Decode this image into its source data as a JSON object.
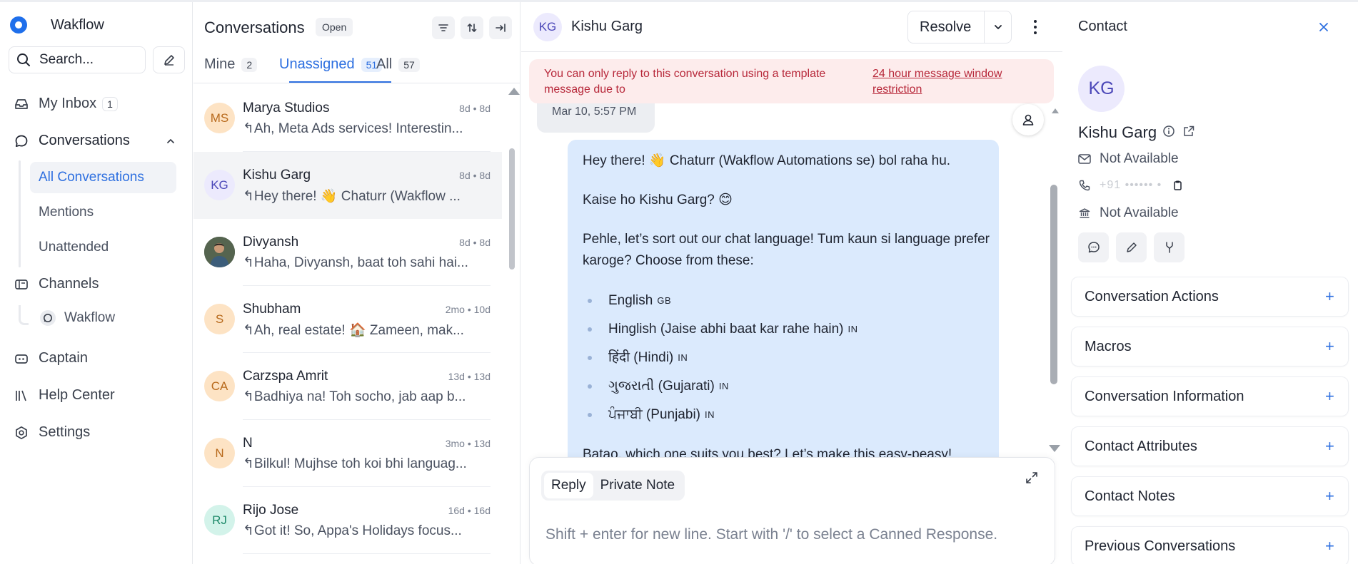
{
  "app": {
    "name": "Wakflow"
  },
  "nav": {
    "search_placeholder": "Search...",
    "my_inbox": {
      "label": "My Inbox",
      "count": "1"
    },
    "conversations_label": "Conversations",
    "sub_items": [
      {
        "label": "All Conversations",
        "active": true
      },
      {
        "label": "Mentions",
        "active": false
      },
      {
        "label": "Unattended",
        "active": false
      }
    ],
    "channels_label": "Channels",
    "channel_item": "Wakflow",
    "captain_label": "Captain",
    "help_center_label": "Help Center",
    "settings_label": "Settings"
  },
  "list": {
    "title": "Conversations",
    "status_pill": "Open",
    "tabs": [
      {
        "label": "Mine",
        "count": "2"
      },
      {
        "label": "Unassigned",
        "count": "51"
      },
      {
        "label": "All",
        "count": "57"
      }
    ],
    "conversations": [
      {
        "initials": "MS",
        "name": "Marya Studios",
        "time": "8d • 8d",
        "message": "↰Ah, Meta Ads services! Interestin...",
        "avatar_bg": "#fde3c4",
        "avatar_fg": "#b86a1c"
      },
      {
        "initials": "KG",
        "name": "Kishu Garg",
        "time": "8d • 8d",
        "message": "↰Hey there! 👋 Chaturr (Wakflow ...",
        "avatar_bg": "#eceafd",
        "avatar_fg": "#4b47b8"
      },
      {
        "initials": "",
        "name": "Divyansh",
        "time": "8d • 8d",
        "message": "↰Haha, Divyansh, baat toh sahi hai...",
        "avatar_bg": "#3e4a3c",
        "avatar_fg": "#ffffff"
      },
      {
        "initials": "S",
        "name": "Shubham",
        "time": "2mo • 10d",
        "message": "↰Ah, real estate! 🏠 Zameen, mak...",
        "avatar_bg": "#fde3c4",
        "avatar_fg": "#b86a1c"
      },
      {
        "initials": "CA",
        "name": "Carzspa Amrit",
        "time": "13d • 13d",
        "message": "↰Badhiya na! Toh socho, jab aap b...",
        "avatar_bg": "#fde3c4",
        "avatar_fg": "#b86a1c"
      },
      {
        "initials": "N",
        "name": "N",
        "time": "3mo • 13d",
        "message": "↰Bilkul! Mujhse toh koi bhi languag...",
        "avatar_bg": "#fde3c4",
        "avatar_fg": "#b86a1c"
      },
      {
        "initials": "RJ",
        "name": "Rijo Jose",
        "time": "16d • 16d",
        "message": "↰Got it! So, Appa's Holidays focus...",
        "avatar_bg": "#d3f3ea",
        "avatar_fg": "#1f8a6a"
      }
    ]
  },
  "chat": {
    "contact_initials": "KG",
    "contact_name": "Kishu Garg",
    "resolve_label": "Resolve",
    "warning_text": "You can only reply to this conversation using a template message due to",
    "warning_link": "24 hour message window restriction",
    "prev_timestamp": "Mar 10, 5:57 PM",
    "message": {
      "p1": "Hey there! 👋 Chaturr (Wakflow Automations se) bol raha hu.",
      "p2": "Kaise ho Kishu Garg? 😊",
      "p3": "Pehle, let’s sort out our chat language! Tum kaun si language prefer karoge? Choose from these:",
      "options": [
        {
          "text": "English",
          "flag": "GB"
        },
        {
          "text": "Hinglish (Jaise abhi baat kar rahe hain)",
          "flag": "IN"
        },
        {
          "text": "हिंदी (Hindi)",
          "flag": "IN"
        },
        {
          "text": "ગુજરાતી (Gujarati)",
          "flag": "IN"
        },
        {
          "text": "ਪੰਜਾਬੀ (Punjabi)",
          "flag": "IN"
        }
      ],
      "p4": "Batao, which one suits you best? Let’s make this easy-peasy!"
    },
    "reply_tabs": [
      "Reply",
      "Private Note"
    ],
    "reply_placeholder": "Shift + enter for new line. Start with '/' to select a Canned Response."
  },
  "contact": {
    "title": "Contact",
    "initials": "KG",
    "name": "Kishu Garg",
    "email": "Not Available",
    "phone": "+91 •••••• •",
    "company": "Not Available",
    "sections": [
      "Conversation Actions",
      "Macros",
      "Conversation Information",
      "Contact Attributes",
      "Contact Notes",
      "Previous Conversations"
    ]
  }
}
